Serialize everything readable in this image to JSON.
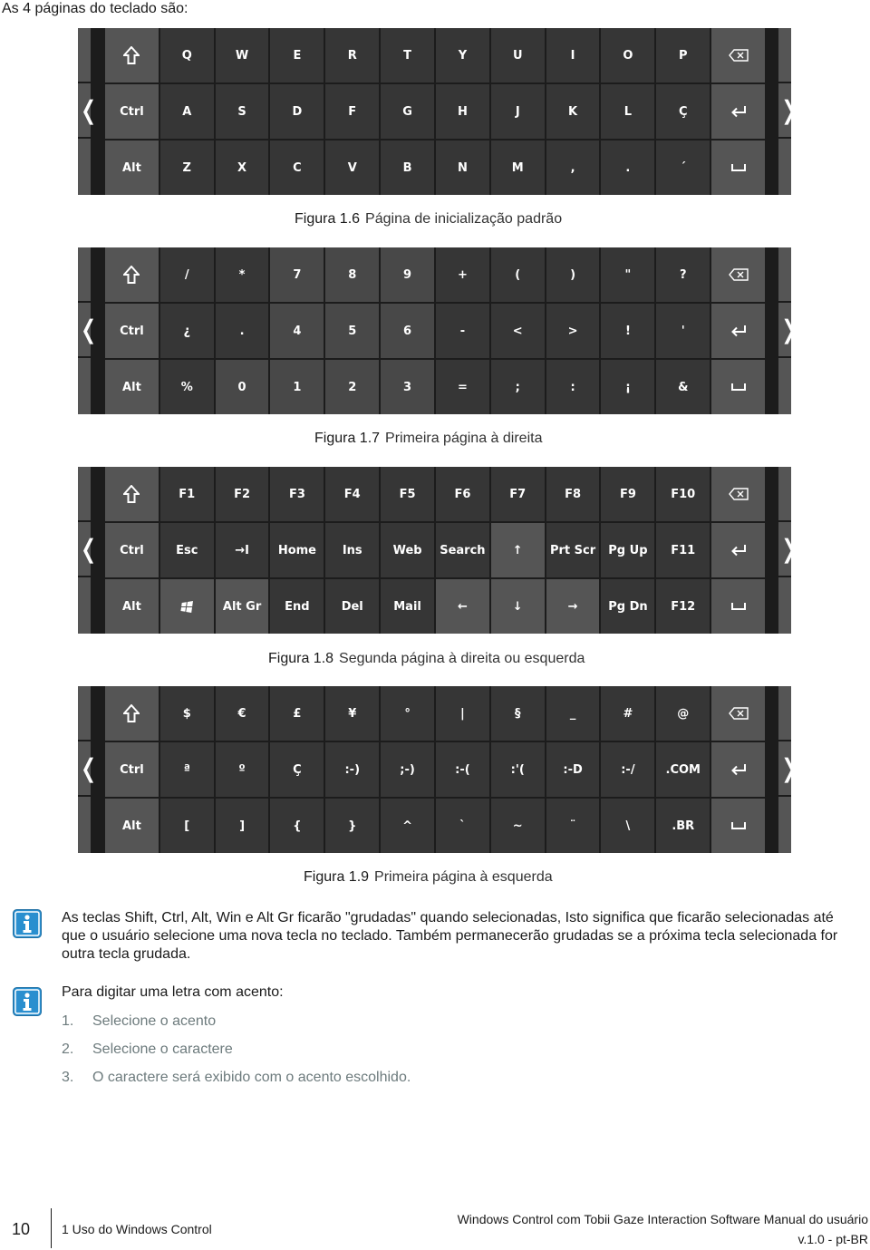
{
  "intro": "As 4 páginas do teclado são:",
  "keyboards": [
    {
      "caption_num": "Figura 1.6",
      "caption_text": "Página de inicialização padrão",
      "rows": [
        [
          {
            "label": "shift-icon",
            "icon": "shift",
            "tone": "light"
          },
          {
            "label": "Q"
          },
          {
            "label": "W"
          },
          {
            "label": "E"
          },
          {
            "label": "R"
          },
          {
            "label": "T"
          },
          {
            "label": "Y"
          },
          {
            "label": "U"
          },
          {
            "label": "I"
          },
          {
            "label": "O"
          },
          {
            "label": "P"
          },
          {
            "label": "backspace-icon",
            "icon": "backspace",
            "tone": "light"
          }
        ],
        [
          {
            "label": "Ctrl",
            "tone": "light"
          },
          {
            "label": "A"
          },
          {
            "label": "S"
          },
          {
            "label": "D"
          },
          {
            "label": "F"
          },
          {
            "label": "G"
          },
          {
            "label": "H"
          },
          {
            "label": "J"
          },
          {
            "label": "K"
          },
          {
            "label": "L"
          },
          {
            "label": "Ç"
          },
          {
            "label": "enter-icon",
            "icon": "enter",
            "tone": "light"
          }
        ],
        [
          {
            "label": "Alt",
            "tone": "light"
          },
          {
            "label": "Z"
          },
          {
            "label": "X"
          },
          {
            "label": "C"
          },
          {
            "label": "V"
          },
          {
            "label": "B"
          },
          {
            "label": "N"
          },
          {
            "label": "M"
          },
          {
            "label": ","
          },
          {
            "label": "."
          },
          {
            "label": "´"
          },
          {
            "label": "space-icon",
            "icon": "space",
            "tone": "light"
          }
        ]
      ]
    },
    {
      "caption_num": "Figura 1.7",
      "caption_text": "Primeira página à direita",
      "rows": [
        [
          {
            "label": "shift-icon",
            "icon": "shift",
            "tone": "light"
          },
          {
            "label": "/"
          },
          {
            "label": "*"
          },
          {
            "label": "7",
            "tone": "mid"
          },
          {
            "label": "8",
            "tone": "mid"
          },
          {
            "label": "9",
            "tone": "mid"
          },
          {
            "label": "+"
          },
          {
            "label": "("
          },
          {
            "label": ")"
          },
          {
            "label": "\""
          },
          {
            "label": "?"
          },
          {
            "label": "backspace-icon",
            "icon": "backspace",
            "tone": "light"
          }
        ],
        [
          {
            "label": "Ctrl",
            "tone": "light"
          },
          {
            "label": "¿"
          },
          {
            "label": "."
          },
          {
            "label": "4",
            "tone": "mid"
          },
          {
            "label": "5",
            "tone": "mid"
          },
          {
            "label": "6",
            "tone": "mid"
          },
          {
            "label": "-"
          },
          {
            "label": "<"
          },
          {
            "label": ">"
          },
          {
            "label": "!"
          },
          {
            "label": "'"
          },
          {
            "label": "enter-icon",
            "icon": "enter",
            "tone": "light"
          }
        ],
        [
          {
            "label": "Alt",
            "tone": "light"
          },
          {
            "label": "%"
          },
          {
            "label": "0",
            "tone": "mid"
          },
          {
            "label": "1",
            "tone": "mid"
          },
          {
            "label": "2",
            "tone": "mid"
          },
          {
            "label": "3",
            "tone": "mid"
          },
          {
            "label": "="
          },
          {
            "label": ";"
          },
          {
            "label": ":"
          },
          {
            "label": "¡"
          },
          {
            "label": "&"
          },
          {
            "label": "space-icon",
            "icon": "space",
            "tone": "light"
          }
        ]
      ]
    },
    {
      "caption_num": "Figura 1.8",
      "caption_text": "Segunda página à direita ou esquerda",
      "rows": [
        [
          {
            "label": "shift-icon",
            "icon": "shift",
            "tone": "light"
          },
          {
            "label": "F1"
          },
          {
            "label": "F2"
          },
          {
            "label": "F3"
          },
          {
            "label": "F4"
          },
          {
            "label": "F5"
          },
          {
            "label": "F6"
          },
          {
            "label": "F7"
          },
          {
            "label": "F8"
          },
          {
            "label": "F9"
          },
          {
            "label": "F10"
          },
          {
            "label": "backspace-icon",
            "icon": "backspace",
            "tone": "light"
          }
        ],
        [
          {
            "label": "Ctrl",
            "tone": "light"
          },
          {
            "label": "Esc"
          },
          {
            "label": "→I"
          },
          {
            "label": "Home"
          },
          {
            "label": "Ins"
          },
          {
            "label": "Web"
          },
          {
            "label": "Search"
          },
          {
            "label": "↑",
            "tone": "light"
          },
          {
            "label": "Prt Scr"
          },
          {
            "label": "Pg Up"
          },
          {
            "label": "F11"
          },
          {
            "label": "enter-icon",
            "icon": "enter",
            "tone": "light"
          }
        ],
        [
          {
            "label": "Alt",
            "tone": "light"
          },
          {
            "label": "windows-icon",
            "icon": "windows",
            "tone": "light"
          },
          {
            "label": "Alt Gr",
            "tone": "light"
          },
          {
            "label": "End"
          },
          {
            "label": "Del"
          },
          {
            "label": "Mail"
          },
          {
            "label": "←",
            "tone": "light"
          },
          {
            "label": "↓",
            "tone": "light"
          },
          {
            "label": "→",
            "tone": "light"
          },
          {
            "label": "Pg Dn"
          },
          {
            "label": "F12"
          },
          {
            "label": "space-icon",
            "icon": "space",
            "tone": "light"
          }
        ]
      ]
    },
    {
      "caption_num": "Figura 1.9",
      "caption_text": "Primeira página à esquerda",
      "rows": [
        [
          {
            "label": "shift-icon",
            "icon": "shift",
            "tone": "light"
          },
          {
            "label": "$"
          },
          {
            "label": "€"
          },
          {
            "label": "£"
          },
          {
            "label": "¥"
          },
          {
            "label": "°"
          },
          {
            "label": "|"
          },
          {
            "label": "§"
          },
          {
            "label": "_"
          },
          {
            "label": "#"
          },
          {
            "label": "@"
          },
          {
            "label": "backspace-icon",
            "icon": "backspace",
            "tone": "light"
          }
        ],
        [
          {
            "label": "Ctrl",
            "tone": "light"
          },
          {
            "label": "ª"
          },
          {
            "label": "º"
          },
          {
            "label": "Ç"
          },
          {
            "label": ":-)"
          },
          {
            "label": ";-)"
          },
          {
            "label": ":-("
          },
          {
            "label": ":'("
          },
          {
            "label": ":-D"
          },
          {
            "label": ":-/"
          },
          {
            "label": ".COM"
          },
          {
            "label": "enter-icon",
            "icon": "enter",
            "tone": "light"
          }
        ],
        [
          {
            "label": "Alt",
            "tone": "light"
          },
          {
            "label": "["
          },
          {
            "label": "]"
          },
          {
            "label": "{"
          },
          {
            "label": "}"
          },
          {
            "label": "^"
          },
          {
            "label": "`"
          },
          {
            "label": "~"
          },
          {
            "label": "¨"
          },
          {
            "label": "\\"
          },
          {
            "label": ".BR"
          },
          {
            "label": "space-icon",
            "icon": "space",
            "tone": "light"
          }
        ]
      ]
    }
  ],
  "nav": {
    "left_chevron": "❬",
    "right_chevron": "❭"
  },
  "notes": {
    "sticky_keys": "As teclas Shift, Ctrl, Alt, Win e Alt Gr ficarão \"grudadas\" quando selecionadas, Isto significa que ficarão selecionadas até que o usuário selecione uma nova tecla no teclado. Também permanecerão grudadas se a próxima tecla selecionada for outra tecla grudada.",
    "accent_intro": "Para digitar uma letra com acento:",
    "steps": [
      {
        "n": "1.",
        "text": "Selecione o acento"
      },
      {
        "n": "2.",
        "text": "Selecione o caractere"
      },
      {
        "n": "3.",
        "text": "O caractere será exibido com o acento escolhido."
      }
    ],
    "icon": "info-icon",
    "icon_color": "#2a8fcf"
  },
  "footer": {
    "page_number": "10",
    "chapter": "1 Uso do Windows Control",
    "doc_title": "Windows Control com Tobii Gaze Interaction Software Manual do usuário",
    "version": "v.1.0 - pt-BR"
  },
  "colors": {
    "key_dark": "#363636",
    "key_light": "#555555",
    "key_mid": "#484848",
    "keyboard_bg": "#1c1c1c",
    "step_text": "#6d7b7d"
  }
}
